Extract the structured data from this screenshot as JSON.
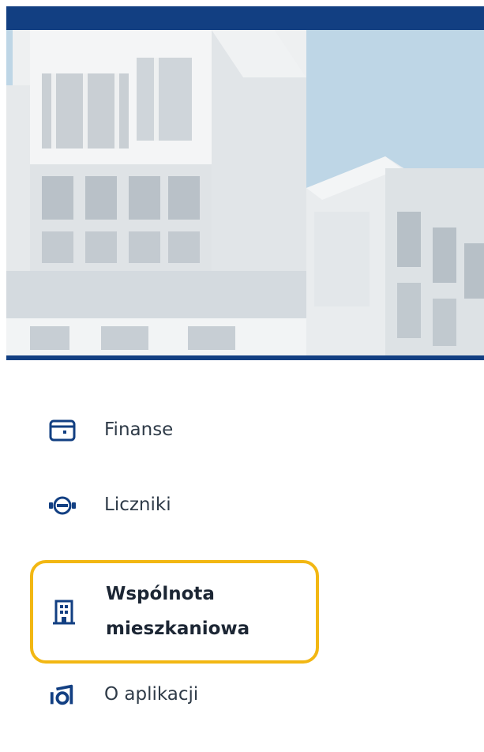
{
  "menu": {
    "items": [
      {
        "label": "Finanse",
        "icon": "wallet-icon",
        "active": false
      },
      {
        "label": "Liczniki",
        "icon": "meter-icon",
        "active": false
      },
      {
        "label": "Wspólnota mieszkaniowa",
        "icon": "building-icon",
        "active": true
      },
      {
        "label": "O aplikacji",
        "icon": "about-app-icon",
        "active": false
      }
    ]
  },
  "colors": {
    "brand": "#123f82",
    "highlight": "#f2b713",
    "text": "#2f3b48",
    "sky": "#bfd6e6"
  }
}
